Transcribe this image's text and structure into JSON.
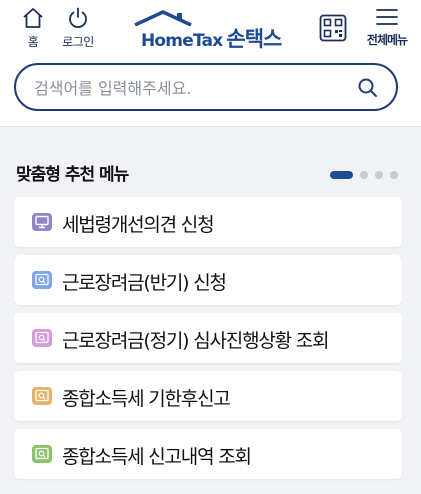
{
  "header": {
    "home_label": "홈",
    "login_label": "로그인",
    "logo_text": "HomeTax",
    "logo_suffix": "손택스",
    "menu_label": "전체메뉴",
    "brand_color": "#1f4b94"
  },
  "search": {
    "placeholder": "검색어를 입력해주세요."
  },
  "recommend": {
    "title": "맞춤형 추천 메뉴",
    "page_count": 4,
    "active_page": 1,
    "items": [
      {
        "label": "세법령개선의견 신청",
        "icon": "monitor-icon",
        "color": "#8d86c9"
      },
      {
        "label": "근로장려금(반기) 신청",
        "icon": "search-doc-icon",
        "color": "#7fa6e8"
      },
      {
        "label": "근로장려금(정기) 심사진행상황 조회",
        "icon": "search-doc-icon",
        "color": "#d79ad9"
      },
      {
        "label": "종합소득세 기한후신고",
        "icon": "search-doc-icon",
        "color": "#e7b36c"
      },
      {
        "label": "종합소득세 신고내역 조회",
        "icon": "search-doc-icon",
        "color": "#8dc26b"
      }
    ]
  }
}
